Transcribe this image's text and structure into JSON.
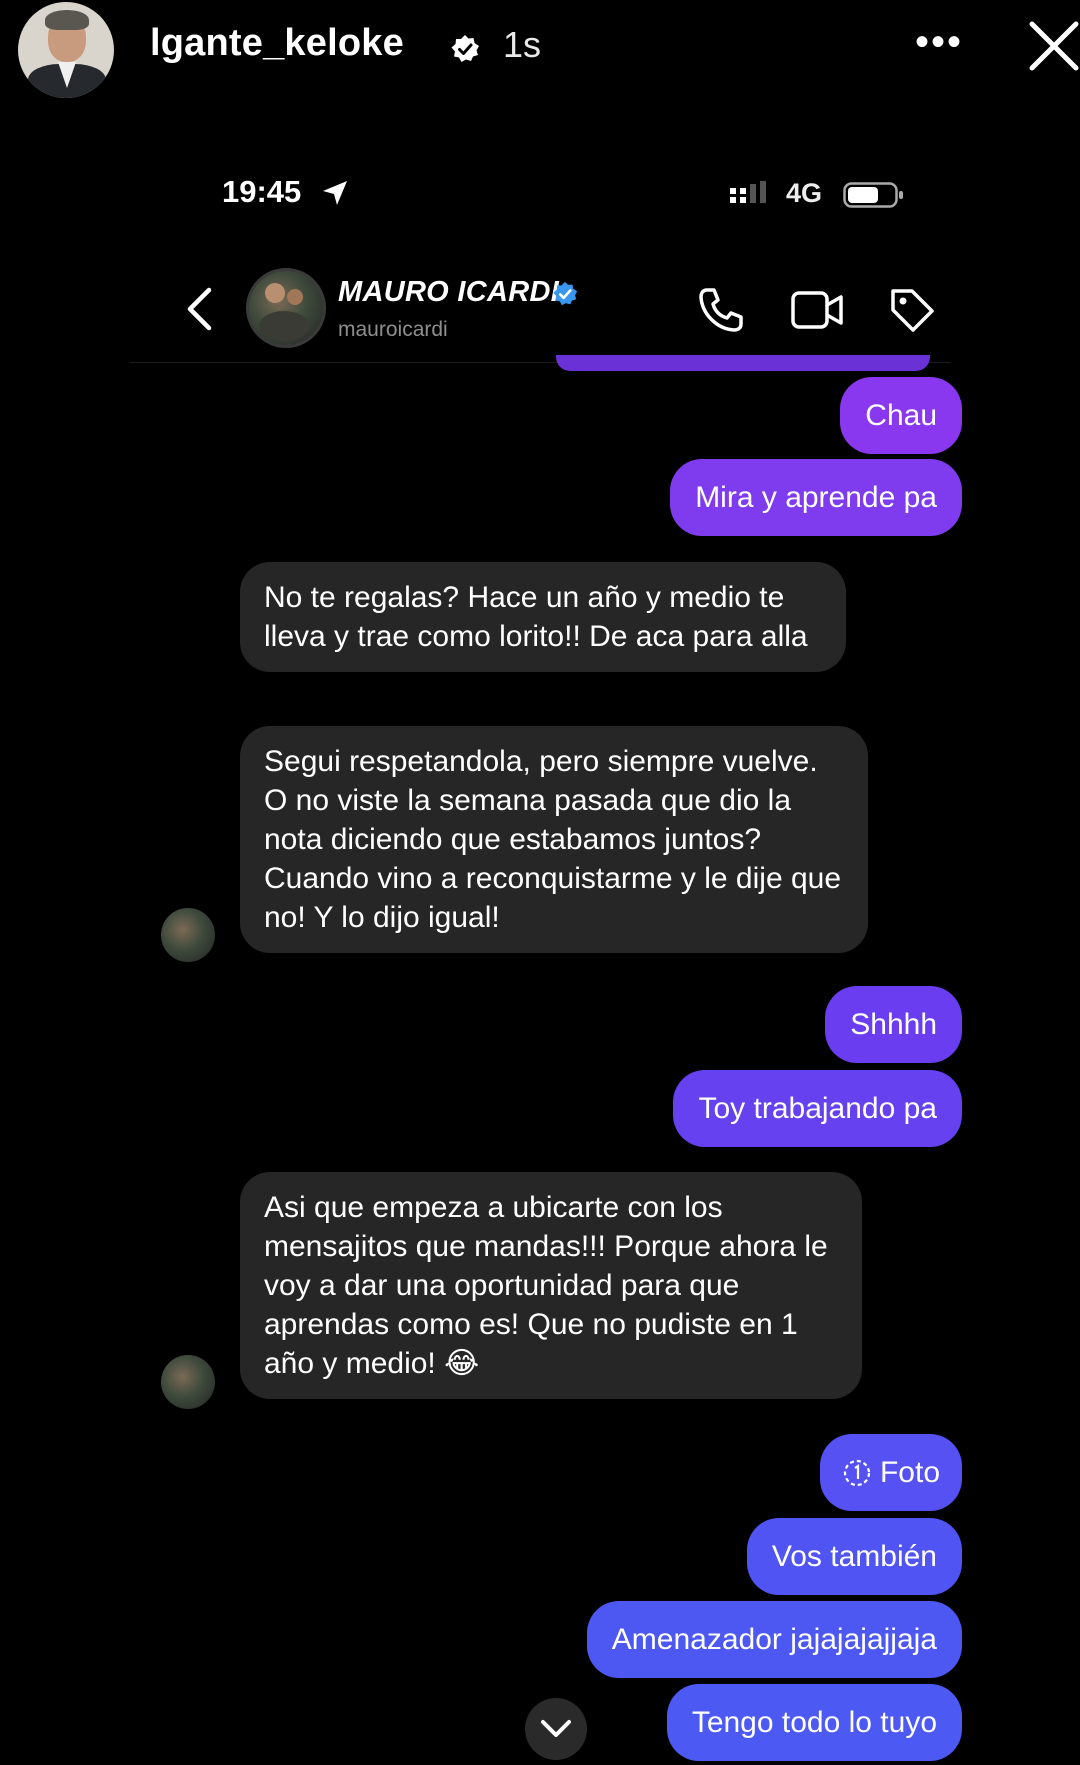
{
  "story": {
    "username": "lgante_keloke",
    "time_ago": "1s"
  },
  "status_bar": {
    "time": "19:45",
    "network": "4G"
  },
  "chat_header": {
    "name": "MAURO ICARDI",
    "handle": "mauroicardi"
  },
  "messages": [
    {
      "from": "me",
      "text": "Chau"
    },
    {
      "from": "me",
      "text": "Mira y aprende pa"
    },
    {
      "from": "them",
      "text": "No te regalas? Hace un año y medio te lleva y trae como lorito!! De aca para alla"
    },
    {
      "from": "them",
      "text": "Segui respetandola, pero siempre vuelve. O no viste la semana pasada que dio la nota diciendo que estabamos juntos? Cuando vino a reconquistarme y le dije que no! Y lo dijo igual!"
    },
    {
      "from": "me",
      "text": "Shhhh"
    },
    {
      "from": "me",
      "text": "Toy trabajando pa"
    },
    {
      "from": "them",
      "text": "Asi que empeza a ubicarte con los mensajitos que mandas!!! Porque ahora le voy a dar una oportunidad para que aprendas como es! Que no pudiste en 1 año y medio! 😂"
    },
    {
      "from": "me",
      "text": "Foto",
      "icon": "view-once-icon"
    },
    {
      "from": "me",
      "text": "Vos también"
    },
    {
      "from": "me",
      "text": "Amenazador jajajajajjaja"
    },
    {
      "from": "me",
      "text": "Tengo todo lo tuyo"
    }
  ],
  "colors": {
    "purple": "#7c3aed",
    "violet": "#6a3ef0",
    "blue": "#4f5cf2",
    "incoming": "#262626",
    "background": "#000000"
  }
}
